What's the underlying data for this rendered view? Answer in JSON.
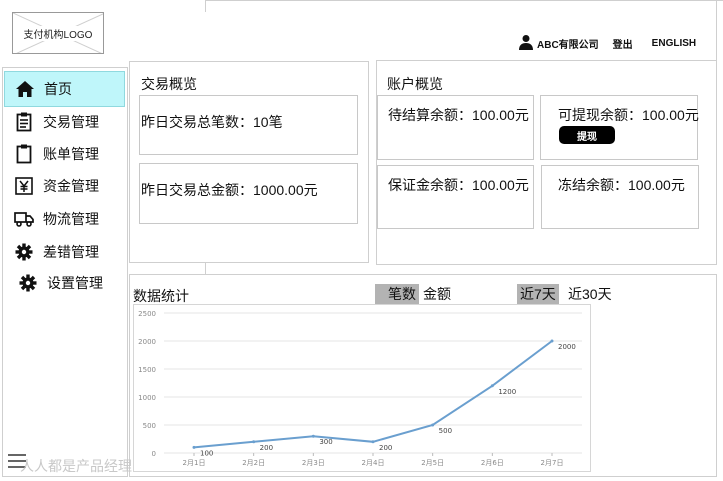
{
  "header": {
    "logo_text": "支付机构LOGO",
    "company": "ABC有限公司",
    "logout": "登出",
    "language": "ENGLISH"
  },
  "sidebar": {
    "items": [
      {
        "label": "首页",
        "icon": "home-icon",
        "active": true
      },
      {
        "label": "交易管理",
        "icon": "clipboard-list-icon"
      },
      {
        "label": "账单管理",
        "icon": "clipboard-icon"
      },
      {
        "label": "资金管理",
        "icon": "yen-box-icon"
      },
      {
        "label": "物流管理",
        "icon": "truck-icon"
      },
      {
        "label": "差错管理",
        "icon": "gear-icon"
      },
      {
        "label": "设置管理",
        "icon": "gear-icon"
      }
    ]
  },
  "transaction_overview": {
    "title": "交易概览",
    "count_text": "昨日交易总笔数：10笔",
    "amount_text": "昨日交易总金额：1000.00元"
  },
  "account_overview": {
    "title": "账户概览",
    "pending": "待结算余额：100.00元",
    "withdrawable": "可提现余额：100.00元",
    "withdraw_button": "提现",
    "deposit": "保证金余额：100.00元",
    "frozen": "冻结余额：100.00元"
  },
  "stats": {
    "title": "数据统计",
    "metric_tabs": [
      "笔数",
      "金额"
    ],
    "range_tabs": [
      "近7天",
      "近30天"
    ]
  },
  "chart_data": {
    "type": "line",
    "categories": [
      "2月1日",
      "2月2日",
      "2月3日",
      "2月4日",
      "2月5日",
      "2月6日",
      "2月7日"
    ],
    "series": [
      {
        "values": [
          100,
          200,
          300,
          200,
          500,
          1200,
          2000
        ]
      }
    ],
    "ylim": [
      0,
      2500
    ],
    "yticks": [
      0,
      500,
      1000,
      1500,
      2000,
      2500
    ],
    "grid": true,
    "color": "#6a9fcf"
  },
  "watermark": "人人都是产品经理"
}
